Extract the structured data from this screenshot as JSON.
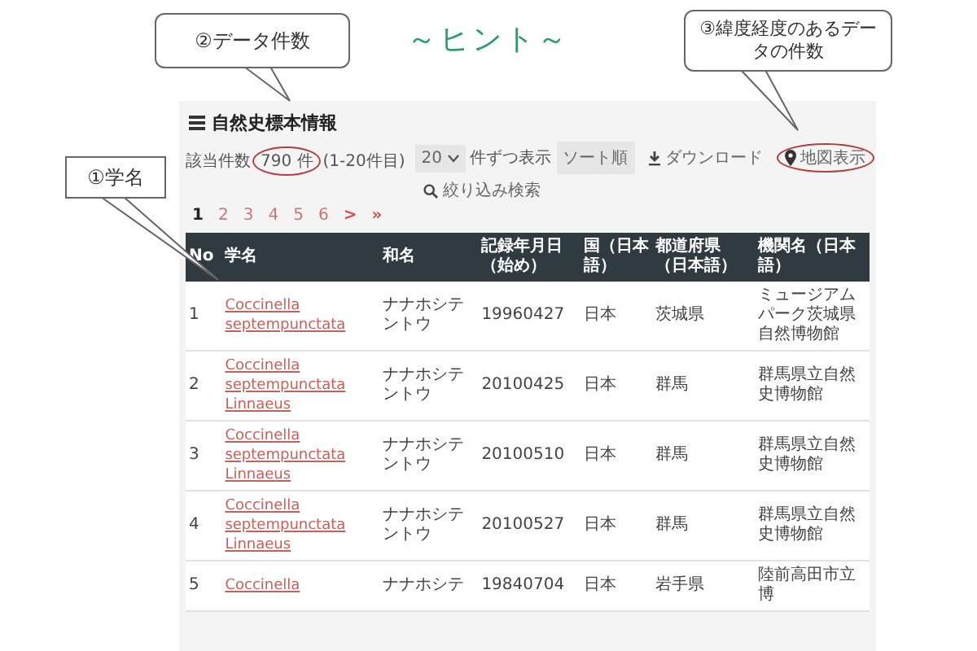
{
  "banner": {
    "title": "～ヒント～"
  },
  "callouts": [
    {
      "kind": "name",
      "text": "①学名"
    },
    {
      "kind": "count",
      "text": "②データ件数"
    },
    {
      "kind": "map",
      "text": "③緯度経度のあるデータの件数"
    }
  ],
  "panel": {
    "title": "自然史標本情報",
    "result": {
      "label": "該当件数",
      "count": "790 件",
      "count_highlighted": true,
      "range": "(1-20件目)"
    },
    "per_page": {
      "value": "20",
      "label": "件ずつ表示"
    },
    "sort": {
      "label": "ソート順"
    },
    "download": {
      "label": "ダウンロード"
    },
    "map": {
      "label": "地図表示",
      "highlighted": true
    },
    "filter": {
      "label": "絞り込み検索"
    },
    "pagination": {
      "pages": [
        {
          "label": "1",
          "selected": true
        },
        {
          "label": "2",
          "selected": false
        },
        {
          "label": "3",
          "selected": false
        },
        {
          "label": "4",
          "selected": false
        },
        {
          "label": "5",
          "selected": false
        },
        {
          "label": "6",
          "selected": false
        }
      ],
      "next": ">",
      "last": "»"
    }
  },
  "table": {
    "columns": [
      "No",
      "学名",
      "和名",
      "記録年月日（始め）",
      "国（日本語）",
      "都道府県（日本語）",
      "機関名（日本語）"
    ],
    "rows": [
      {
        "no": "1",
        "scientific_name": "Coccinella septempunctata",
        "japanese_name": "ナナホシテントウ",
        "date": "19960427",
        "country": "日本",
        "prefecture": "茨城県",
        "institution": "ミュージアムパーク茨城県自然博物館"
      },
      {
        "no": "2",
        "scientific_name": "Coccinella septempunctata Linnaeus",
        "japanese_name": "ナナホシテントウ",
        "date": "20100425",
        "country": "日本",
        "prefecture": "群馬",
        "institution": "群馬県立自然史博物館"
      },
      {
        "no": "3",
        "scientific_name": "Coccinella septempunctata Linnaeus",
        "japanese_name": "ナナホシテントウ",
        "date": "20100510",
        "country": "日本",
        "prefecture": "群馬",
        "institution": "群馬県立自然史博物館"
      },
      {
        "no": "4",
        "scientific_name": "Coccinella septempunctata Linnaeus",
        "japanese_name": "ナナホシテントウ",
        "date": "20100527",
        "country": "日本",
        "prefecture": "群馬",
        "institution": "群馬県立自然史博物館"
      },
      {
        "no": "5",
        "scientific_name": "Coccinella",
        "japanese_name": "ナナホシテ",
        "date": "19840704",
        "country": "日本",
        "prefecture": "岩手県",
        "institution": "陸前高田市立博"
      }
    ]
  }
}
